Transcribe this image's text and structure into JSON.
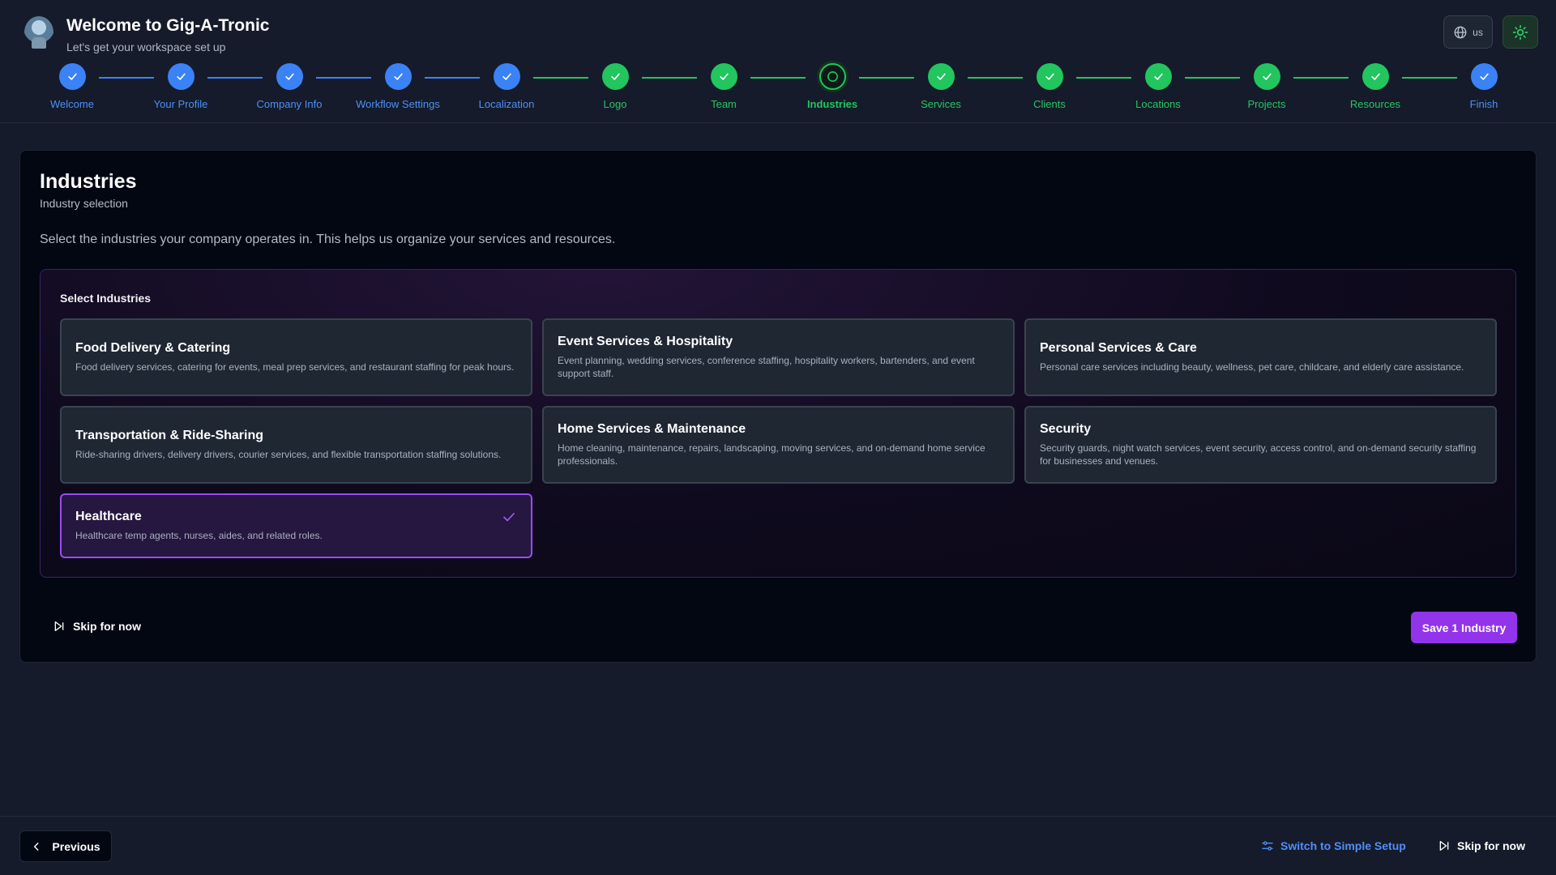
{
  "header": {
    "title": "Welcome to Gig-A-Tronic",
    "subtitle": "Let's get your workspace set up",
    "language": "us"
  },
  "steps": [
    {
      "label": "Welcome",
      "state": "done-blue"
    },
    {
      "label": "Your Profile",
      "state": "done-blue"
    },
    {
      "label": "Company Info",
      "state": "done-blue"
    },
    {
      "label": "Workflow Settings",
      "state": "done-blue"
    },
    {
      "label": "Localization",
      "state": "done-blue"
    },
    {
      "label": "Logo",
      "state": "done-green"
    },
    {
      "label": "Team",
      "state": "done-green"
    },
    {
      "label": "Industries",
      "state": "current"
    },
    {
      "label": "Services",
      "state": "done-green"
    },
    {
      "label": "Clients",
      "state": "done-green"
    },
    {
      "label": "Locations",
      "state": "done-green"
    },
    {
      "label": "Projects",
      "state": "done-green"
    },
    {
      "label": "Resources",
      "state": "done-green"
    },
    {
      "label": "Finish",
      "state": "done-blue"
    }
  ],
  "main": {
    "title": "Industries",
    "subtitle": "Industry selection",
    "description": "Select the industries your company operates in. This helps us organize your services and resources.",
    "panel_title": "Select Industries",
    "industries": [
      {
        "title": "Food Delivery & Catering",
        "description": "Food delivery services, catering for events, meal prep services, and restaurant staffing for peak hours.",
        "selected": false
      },
      {
        "title": "Event Services & Hospitality",
        "description": "Event planning, wedding services, conference staffing, hospitality workers, bartenders, and event support staff.",
        "selected": false
      },
      {
        "title": "Personal Services & Care",
        "description": "Personal care services including beauty, wellness, pet care, childcare, and elderly care assistance.",
        "selected": false
      },
      {
        "title": "Transportation & Ride-Sharing",
        "description": "Ride-sharing drivers, delivery drivers, courier services, and flexible transportation staffing solutions.",
        "selected": false
      },
      {
        "title": "Home Services & Maintenance",
        "description": "Home cleaning, maintenance, repairs, landscaping, moving services, and on-demand home service professionals.",
        "selected": false
      },
      {
        "title": "Security",
        "description": "Security guards, night watch services, event security, access control, and on-demand security staffing for businesses and venues.",
        "selected": false
      },
      {
        "title": "Healthcare",
        "description": "Healthcare temp agents, nurses, aides, and related roles.",
        "selected": true
      }
    ],
    "skip_label": "Skip for now",
    "save_label": "Save 1 Industry"
  },
  "footer": {
    "previous_label": "Previous",
    "switch_label": "Switch to Simple Setup",
    "skip_label": "Skip for now"
  },
  "colors": {
    "accent_purple": "#9234ea",
    "step_blue": "#3b82f6",
    "step_green": "#22c55e",
    "background": "#151b2a"
  }
}
